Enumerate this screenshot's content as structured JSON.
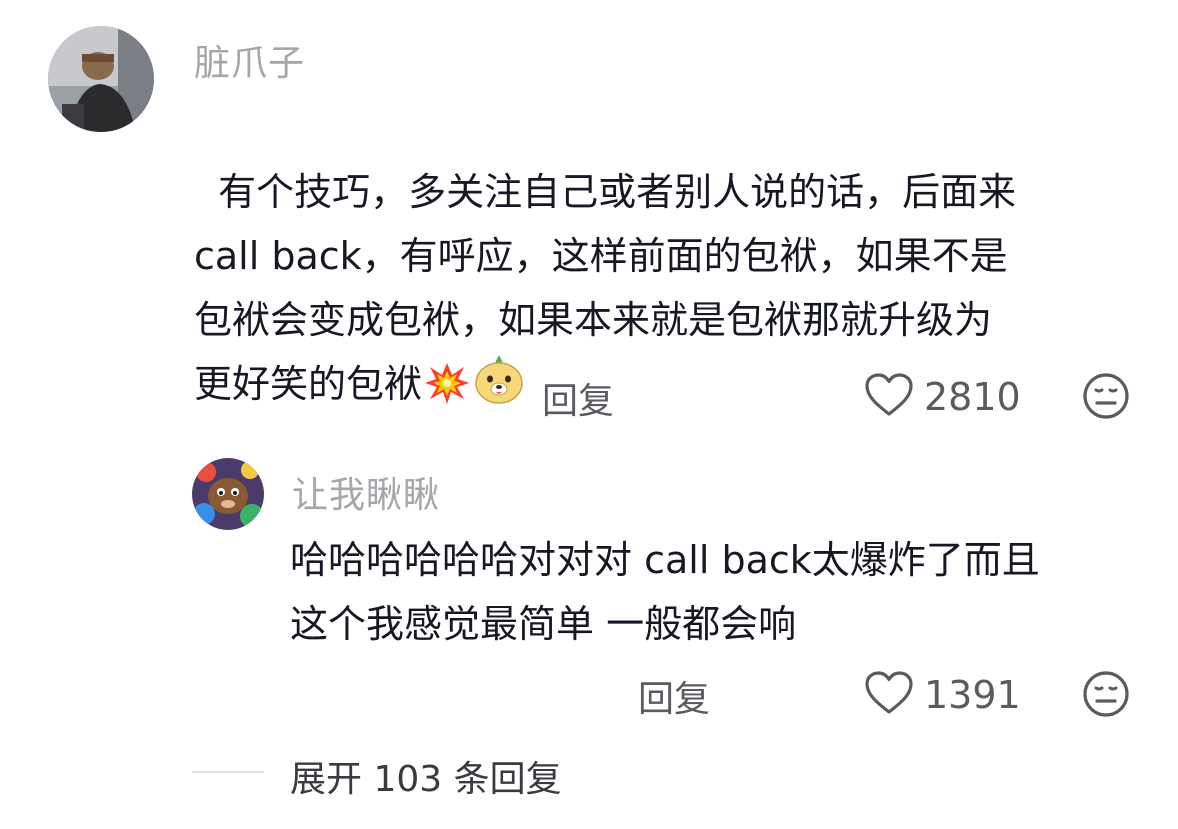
{
  "comment": {
    "username": "脏爪子",
    "text": "有个技巧，多关注自己或者别人说的话，后面来\ncall back，有呼应，这样前面的包袱，如果不是\n包袱会变成包袱，如果本来就是包袱那就升级为\n更好笑的包袱",
    "emojis": [
      "collision-emoji",
      "bear-face-emoji"
    ],
    "reply_label": "回复",
    "like_count": "2810"
  },
  "reply": {
    "username": "让我瞅瞅",
    "text": "哈哈哈哈哈哈对对对 call back太爆炸了而且\n这个我感觉最简单 一般都会响",
    "reply_label": "回复",
    "like_count": "1391"
  },
  "expand": {
    "label": "展开 103 条回复"
  },
  "icons": {
    "like": "heart-outline-icon",
    "dislike": "meh-face-icon"
  },
  "colors": {
    "text": "#161823",
    "username": "#a6a6aa",
    "secondary": "#5a5a60"
  }
}
